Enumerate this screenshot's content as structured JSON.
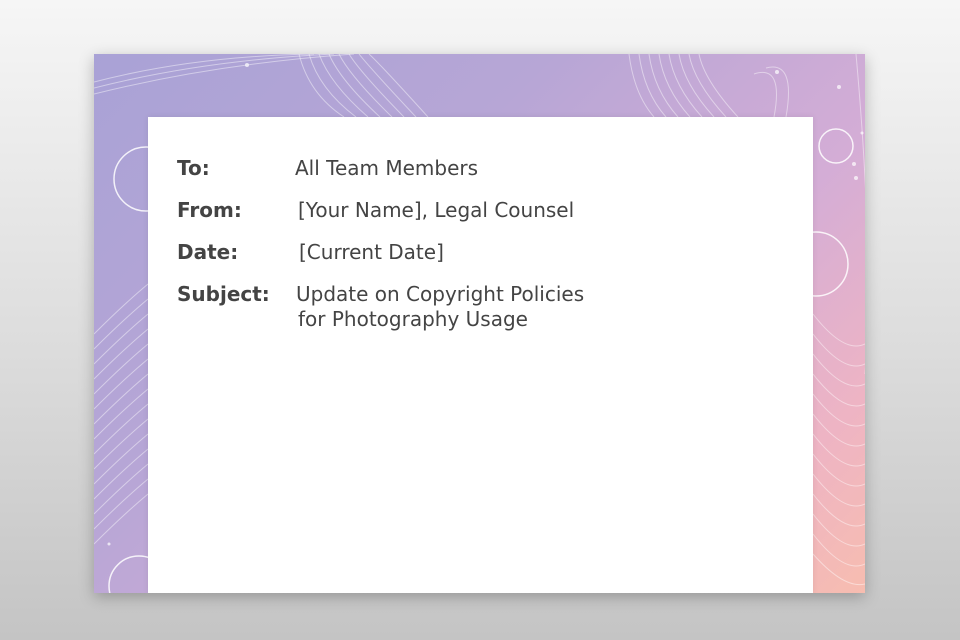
{
  "memo": {
    "to_label": "To:",
    "to_value": "All Team Members",
    "from_label": "From:",
    "from_value": "[Your Name], Legal Counsel",
    "date_label": "Date:",
    "date_value": "[Current Date]",
    "subject_label": "Subject:",
    "subject_line1": "Update on Copyright Policies",
    "subject_line2": "for Photography Usage"
  },
  "colors": {
    "gradient_start": "#a9a2d6",
    "gradient_end": "#f7bdb0",
    "text": "#444444"
  }
}
